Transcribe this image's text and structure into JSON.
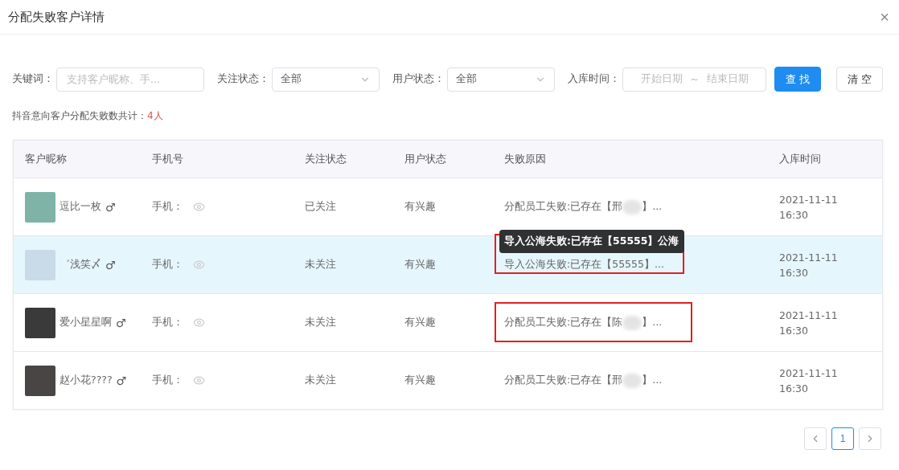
{
  "dialog": {
    "title": "分配失败客户详情",
    "close": "×"
  },
  "filters": {
    "keyword": {
      "label": "关键词：",
      "placeholder": "支持客户昵称、手..."
    },
    "follow_status": {
      "label": "关注状态：",
      "value": "全部"
    },
    "user_status": {
      "label": "用户状态：",
      "value": "全部"
    },
    "date": {
      "label": "入库时间：",
      "start_placeholder": "开始日期",
      "separator": "~",
      "end_placeholder": "结束日期"
    },
    "buttons": [
      {
        "label": "查 找",
        "kind": "primary"
      },
      {
        "label": "清 空",
        "kind": "default"
      }
    ]
  },
  "summary": {
    "label": "抖音意向客户分配失败数共计：",
    "count": "4人"
  },
  "table": {
    "columns": [
      "客户昵称",
      "手机号",
      "关注状态",
      "用户状态",
      "失败原因",
      "入库时间"
    ],
    "rows": [
      {
        "nickname": "逗比一枚",
        "gender": "♂",
        "phone_label": "手机：",
        "follow": "已关注",
        "user_status": "有兴趣",
        "reason_before": "分配员工失败:已存在【邢",
        "reason_after": "】...",
        "blurred": true,
        "annotated": false,
        "date": "2021-11-11",
        "time": "16:30",
        "selected": false
      },
      {
        "nickname": "゛浅笑〆",
        "gender": "♂",
        "phone_label": "手机：",
        "follow": "未关注",
        "user_status": "有兴趣",
        "reason_before": "导入公海失败:已存在【55555】...",
        "reason_after": "",
        "blurred": false,
        "annotated": true,
        "date": "2021-11-11",
        "time": "16:30",
        "selected": true,
        "tooltip": "导入公海失败:已存在【55555】公海"
      },
      {
        "nickname": "爱小星星啊",
        "gender": "♂",
        "phone_label": "手机：",
        "follow": "未关注",
        "user_status": "有兴趣",
        "reason_before": "分配员工失败:已存在【陈",
        "reason_after": "】...",
        "blurred": true,
        "annotated": true,
        "date": "2021-11-11",
        "time": "16:30",
        "selected": false
      },
      {
        "nickname": "赵小花????",
        "gender": "♂",
        "phone_label": "手机：",
        "follow": "未关注",
        "user_status": "有兴趣",
        "reason_before": "分配员工失败:已存在【邢",
        "reason_after": "】...",
        "blurred": true,
        "annotated": false,
        "date": "2021-11-11",
        "time": "16:30",
        "selected": false
      }
    ]
  },
  "pagination": {
    "pages": [
      {
        "label": "1",
        "selected": true
      }
    ]
  }
}
